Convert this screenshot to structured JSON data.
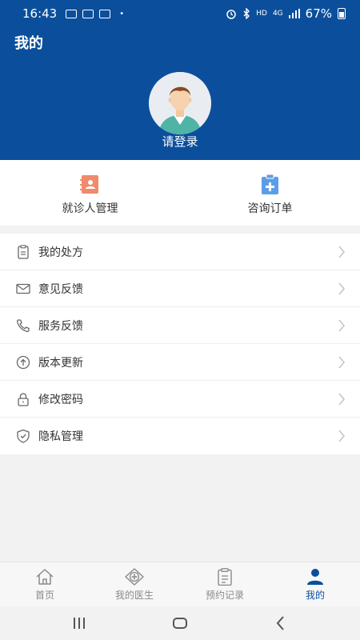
{
  "status_bar": {
    "time": "16:43",
    "dot": "•",
    "hd": "HD",
    "net": "4G",
    "battery": "67%"
  },
  "header": {
    "title": "我的",
    "login_text": "请登录"
  },
  "quick_actions": [
    {
      "label": "就诊人管理",
      "icon": "patient-card-icon",
      "color": "#ef8a6c"
    },
    {
      "label": "咨询订单",
      "icon": "clipboard-plus-icon",
      "color": "#5b9ee8"
    }
  ],
  "menu": [
    {
      "label": "我的处方",
      "icon": "clipboard-icon"
    },
    {
      "label": "意见反馈",
      "icon": "envelope-icon"
    },
    {
      "label": "服务反馈",
      "icon": "phone-icon"
    },
    {
      "label": "版本更新",
      "icon": "upload-circle-icon"
    },
    {
      "label": "修改密码",
      "icon": "lock-icon"
    },
    {
      "label": "隐私管理",
      "icon": "shield-check-icon"
    }
  ],
  "tabs": [
    {
      "label": "首页",
      "icon": "home-icon"
    },
    {
      "label": "我的医生",
      "icon": "medical-cross-icon"
    },
    {
      "label": "预约记录",
      "icon": "clipboard-list-icon"
    },
    {
      "label": "我的",
      "icon": "user-icon",
      "active": true
    }
  ],
  "colors": {
    "primary": "#0b4f9c",
    "inactive": "#8a8a8a"
  }
}
